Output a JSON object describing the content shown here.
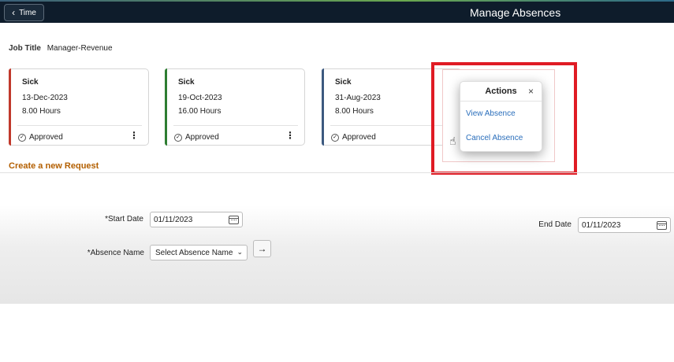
{
  "header": {
    "back_label": "Time",
    "title": "Manage Absences"
  },
  "job": {
    "label": "Job Title",
    "value": "Manager-Revenue"
  },
  "cards": [
    {
      "type": "Sick",
      "date": "13-Dec-2023",
      "hours": "8.00 Hours",
      "status": "Approved",
      "accent": "#c0392b"
    },
    {
      "type": "Sick",
      "date": "19-Oct-2023",
      "hours": "16.00 Hours",
      "status": "Approved",
      "accent": "#2e7d32"
    },
    {
      "type": "Sick",
      "date": "31-Aug-2023",
      "hours": "8.00 Hours",
      "status": "Approved",
      "accent": "#3d5a80"
    }
  ],
  "actions_popover": {
    "title": "Actions",
    "close": "×",
    "items": [
      "View Absence",
      "Cancel Absence"
    ]
  },
  "section": {
    "title": "Create a new Request"
  },
  "form": {
    "start_date_label": "*Start Date",
    "start_date_value": "01/11/2023",
    "end_date_label": "End Date",
    "end_date_value": "01/11/2023",
    "absence_name_label": "*Absence Name",
    "absence_name_value": "Select Absence Name",
    "go_arrow": "→"
  },
  "colors": {
    "header_bg": "#0e1c2b",
    "highlight": "#e01b24",
    "link": "#2a6ebb",
    "section_title": "#b35f00"
  }
}
